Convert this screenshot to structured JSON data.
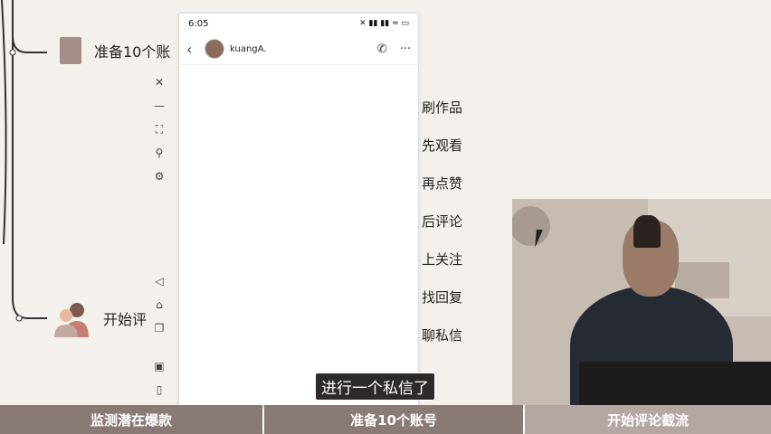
{
  "mindmap": {
    "node_account_label": "准备10个账",
    "node_comment_label": "开始评",
    "steps": [
      "刷作品",
      "先观看",
      "再点赞",
      "后评论",
      "上关注",
      "找回复",
      "聊私信"
    ]
  },
  "phone": {
    "time": "6:05",
    "status_icons": "✕ ▮▮ ▮▮ ≈ ▭",
    "contact_name": "kuangA."
  },
  "subtitle": "进行一个私信了",
  "bottom_nav": {
    "items": [
      "监测潜在爆款",
      "准备10个账号",
      "开始评论截流"
    ]
  },
  "colors": {
    "nav_dark": "#8a7a75",
    "nav_light": "#b4a7a3",
    "nav_active": "#c8bebb",
    "swatch": "#a58f8a"
  }
}
